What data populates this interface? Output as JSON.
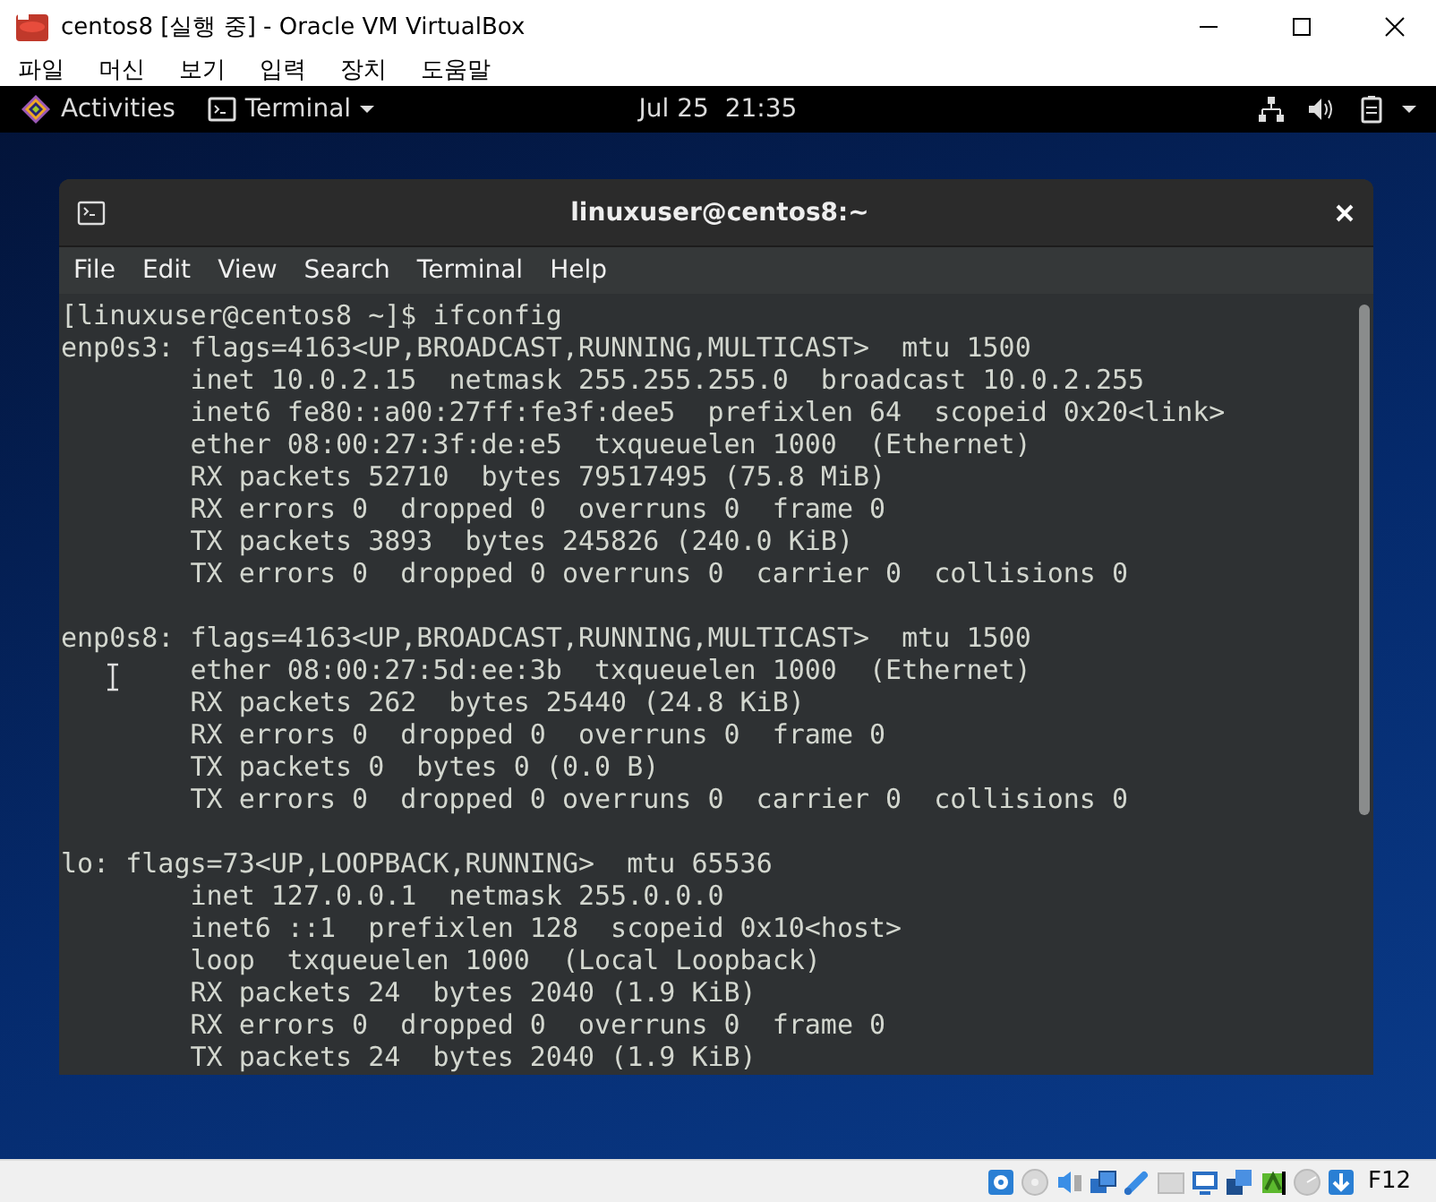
{
  "vm_window": {
    "title": "centos8 [실행 중] - Oracle VM VirtualBox",
    "menu": [
      "파일",
      "머신",
      "보기",
      "입력",
      "장치",
      "도움말"
    ]
  },
  "gnome_bar": {
    "activities": "Activities",
    "app": "Terminal",
    "clock": "Jul 25  21:35"
  },
  "terminal": {
    "title": "linuxuser@centos8:~",
    "menu": [
      "File",
      "Edit",
      "View",
      "Search",
      "Terminal",
      "Help"
    ],
    "prompt": "[linuxuser@centos8 ~]$ ifconfig",
    "interfaces": [
      {
        "header": "enp0s3: flags=4163<UP,BROADCAST,RUNNING,MULTICAST>  mtu 1500",
        "details": [
          "inet 10.0.2.15  netmask 255.255.255.0  broadcast 10.0.2.255",
          "inet6 fe80::a00:27ff:fe3f:dee5  prefixlen 64  scopeid 0x20<link>",
          "ether 08:00:27:3f:de:e5  txqueuelen 1000  (Ethernet)",
          "RX packets 52710  bytes 79517495 (75.8 MiB)",
          "RX errors 0  dropped 0  overruns 0  frame 0",
          "TX packets 3893  bytes 245826 (240.0 KiB)",
          "TX errors 0  dropped 0 overruns 0  carrier 0  collisions 0"
        ]
      },
      {
        "header": "enp0s8: flags=4163<UP,BROADCAST,RUNNING,MULTICAST>  mtu 1500",
        "details": [
          "ether 08:00:27:5d:ee:3b  txqueuelen 1000  (Ethernet)",
          "RX packets 262  bytes 25440 (24.8 KiB)",
          "RX errors 0  dropped 0  overruns 0  frame 0",
          "TX packets 0  bytes 0 (0.0 B)",
          "TX errors 0  dropped 0 overruns 0  carrier 0  collisions 0"
        ]
      },
      {
        "header": "lo: flags=73<UP,LOOPBACK,RUNNING>  mtu 65536",
        "details": [
          "inet 127.0.0.1  netmask 255.0.0.0",
          "inet6 ::1  prefixlen 128  scopeid 0x10<host>",
          "loop  txqueuelen 1000  (Local Loopback)",
          "RX packets 24  bytes 2040 (1.9 KiB)",
          "RX errors 0  dropped 0  overruns 0  frame 0",
          "TX packets 24  bytes 2040 (1.9 KiB)"
        ]
      }
    ]
  },
  "status_bar": {
    "host_key": "F12"
  }
}
